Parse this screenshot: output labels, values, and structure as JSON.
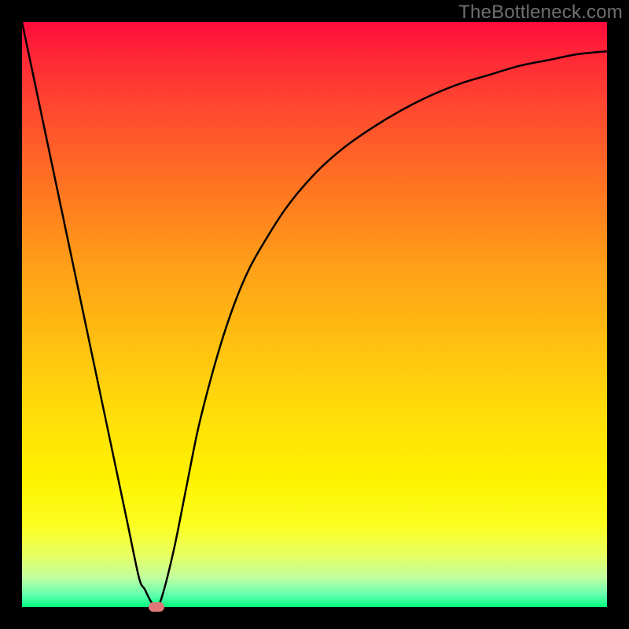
{
  "watermark": "TheBottleneck.com",
  "colors": {
    "frame": "#000000",
    "curve": "#000000",
    "marker": "#e07878"
  },
  "chart_data": {
    "type": "line",
    "title": "",
    "xlabel": "",
    "ylabel": "",
    "xlim": [
      0,
      100
    ],
    "ylim": [
      0,
      100
    ],
    "grid": false,
    "legend": false,
    "annotations": [
      "TheBottleneck.com"
    ],
    "x": [
      0,
      2,
      4,
      6,
      8,
      10,
      12,
      14,
      16,
      18,
      20,
      21,
      22,
      23,
      24,
      26,
      28,
      30,
      32,
      34,
      36,
      38,
      40,
      45,
      50,
      55,
      60,
      65,
      70,
      75,
      80,
      85,
      90,
      95,
      100
    ],
    "y": [
      100,
      90.5,
      81,
      71.5,
      62,
      52.5,
      43,
      33.5,
      24,
      14.5,
      5,
      3,
      1,
      0,
      2,
      10,
      20,
      30,
      38,
      45,
      51,
      56,
      60,
      68,
      74,
      78.5,
      82,
      85,
      87.5,
      89.5,
      91,
      92.5,
      93.5,
      94.5,
      95
    ],
    "marker": {
      "x": 23,
      "y": 0
    },
    "notes": "V-shaped bottleneck curve over vertical red→green gradient; minimum near x≈23%."
  }
}
